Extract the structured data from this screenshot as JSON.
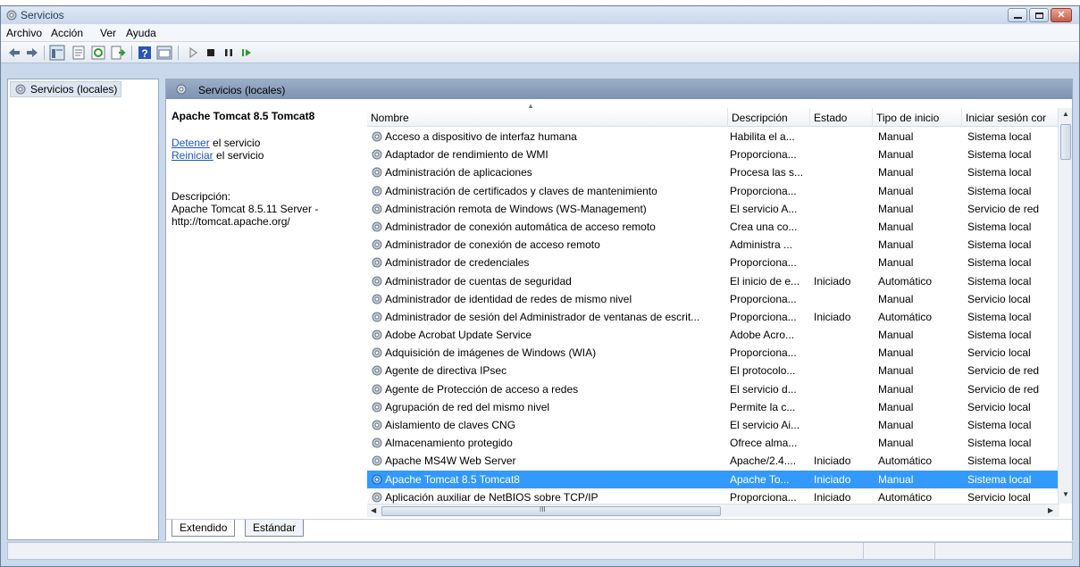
{
  "window": {
    "title": "Servicios"
  },
  "menu": [
    "Archivo",
    "Acción",
    "Ver",
    "Ayuda"
  ],
  "tree": {
    "root_label": "Servicios (locales)"
  },
  "panel": {
    "header": "Servicios (locales)"
  },
  "extended": {
    "service_title": "Apache Tomcat 8.5 Tomcat8",
    "stop_link": "Detener",
    "stop_suffix": " el servicio",
    "restart_link": "Reiniciar",
    "restart_suffix": " el servicio",
    "desc_label": "Descripción:",
    "desc_line1": "Apache Tomcat 8.5.11 Server -",
    "desc_line2": "http://tomcat.apache.org/"
  },
  "table": {
    "columns": [
      "Nombre",
      "Descripción",
      "Estado",
      "Tipo de inicio",
      "Iniciar sesión cor"
    ],
    "rows": [
      {
        "name": "Acceso a dispositivo de interfaz humana",
        "desc": "Habilita el a...",
        "state": "",
        "start": "Manual",
        "logon": "Sistema local"
      },
      {
        "name": "Adaptador de rendimiento de WMI",
        "desc": "Proporciona...",
        "state": "",
        "start": "Manual",
        "logon": "Sistema local"
      },
      {
        "name": "Administración de aplicaciones",
        "desc": "Procesa las s...",
        "state": "",
        "start": "Manual",
        "logon": "Sistema local"
      },
      {
        "name": "Administración de certificados y claves de mantenimiento",
        "desc": "Proporciona...",
        "state": "",
        "start": "Manual",
        "logon": "Sistema local"
      },
      {
        "name": "Administración remota de Windows (WS-Management)",
        "desc": "El servicio A...",
        "state": "",
        "start": "Manual",
        "logon": "Servicio de red"
      },
      {
        "name": "Administrador de conexión automática de acceso remoto",
        "desc": "Crea una co...",
        "state": "",
        "start": "Manual",
        "logon": "Sistema local"
      },
      {
        "name": "Administrador de conexión de acceso remoto",
        "desc": "Administra ...",
        "state": "",
        "start": "Manual",
        "logon": "Sistema local"
      },
      {
        "name": "Administrador de credenciales",
        "desc": "Proporciona...",
        "state": "",
        "start": "Manual",
        "logon": "Sistema local"
      },
      {
        "name": "Administrador de cuentas de seguridad",
        "desc": "El inicio de e...",
        "state": "Iniciado",
        "start": "Automático",
        "logon": "Sistema local"
      },
      {
        "name": "Administrador de identidad de redes de mismo nivel",
        "desc": "Proporciona...",
        "state": "",
        "start": "Manual",
        "logon": "Servicio local"
      },
      {
        "name": "Administrador de sesión del Administrador de ventanas de escrit...",
        "desc": "Proporciona...",
        "state": "Iniciado",
        "start": "Automático",
        "logon": "Sistema local"
      },
      {
        "name": "Adobe Acrobat Update Service",
        "desc": "Adobe Acro...",
        "state": "",
        "start": "Manual",
        "logon": "Sistema local"
      },
      {
        "name": "Adquisición de imágenes de Windows (WIA)",
        "desc": "Proporciona...",
        "state": "",
        "start": "Manual",
        "logon": "Servicio local"
      },
      {
        "name": "Agente de directiva IPsec",
        "desc": "El protocolo...",
        "state": "",
        "start": "Manual",
        "logon": "Servicio de red"
      },
      {
        "name": "Agente de Protección de acceso a redes",
        "desc": "El servicio d...",
        "state": "",
        "start": "Manual",
        "logon": "Servicio de red"
      },
      {
        "name": "Agrupación de red del mismo nivel",
        "desc": "Permite la c...",
        "state": "",
        "start": "Manual",
        "logon": "Servicio local"
      },
      {
        "name": "Aislamiento de claves CNG",
        "desc": "El servicio Ai...",
        "state": "",
        "start": "Manual",
        "logon": "Sistema local"
      },
      {
        "name": "Almacenamiento protegido",
        "desc": "Ofrece alma...",
        "state": "",
        "start": "Manual",
        "logon": "Sistema local"
      },
      {
        "name": "Apache MS4W Web Server",
        "desc": "Apache/2.4....",
        "state": "Iniciado",
        "start": "Automático",
        "logon": "Sistema local"
      },
      {
        "name": "Apache Tomcat 8.5 Tomcat8",
        "desc": "Apache To...",
        "state": "Iniciado",
        "start": "Manual",
        "logon": "Sistema local",
        "selected": true
      },
      {
        "name": "Aplicación auxiliar de NetBIOS sobre TCP/IP",
        "desc": "Proporciona...",
        "state": "Iniciado",
        "start": "Automático",
        "logon": "Servicio local"
      }
    ],
    "scroll_grip": "III"
  },
  "tabs": [
    "Extendido",
    "Estándar"
  ],
  "colors": {
    "selection": "#3399ff",
    "link": "#1a55c0",
    "header_band": "#8da1bd"
  }
}
